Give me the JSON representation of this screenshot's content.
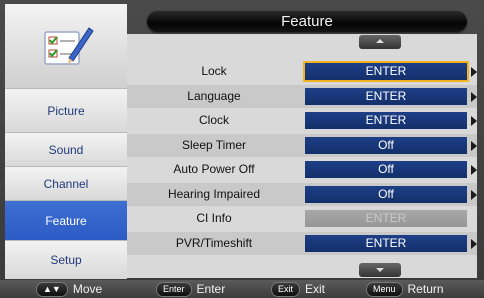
{
  "menu": {
    "title": "Feature"
  },
  "sidebar": {
    "icon": "checklist-pen-icon",
    "items": [
      {
        "label": "Picture",
        "active": false
      },
      {
        "label": "Sound",
        "active": false
      },
      {
        "label": "Channel",
        "active": false
      },
      {
        "label": "Feature",
        "active": true
      },
      {
        "label": "Setup",
        "active": false
      }
    ]
  },
  "feature_rows": [
    {
      "label": "Lock",
      "value": "ENTER",
      "state": "selected",
      "has_arrow": true
    },
    {
      "label": "Language",
      "value": "ENTER",
      "state": "normal",
      "has_arrow": true
    },
    {
      "label": "Clock",
      "value": "ENTER",
      "state": "normal",
      "has_arrow": true
    },
    {
      "label": "Sleep  Timer",
      "value": "Off",
      "state": "normal",
      "has_arrow": true
    },
    {
      "label": "Auto Power Off",
      "value": "Off",
      "state": "normal",
      "has_arrow": true
    },
    {
      "label": "Hearing Impaired",
      "value": "Off",
      "state": "normal",
      "has_arrow": true
    },
    {
      "label": "CI Info",
      "value": "ENTER",
      "state": "disabled",
      "has_arrow": false
    },
    {
      "label": "PVR/Timeshift",
      "value": "ENTER",
      "state": "normal",
      "has_arrow": true
    }
  ],
  "footer": {
    "move": {
      "key": "▲▼",
      "label": "Move"
    },
    "enter": {
      "key": "Enter",
      "label": "Enter"
    },
    "exit": {
      "key": "Exit",
      "label": "Exit"
    },
    "return": {
      "key": "Menu",
      "label": "Return"
    }
  },
  "colors": {
    "value_bg": "#1d3f86",
    "selected_outline": "#f0b422",
    "sidebar_active": "#2c5ac4",
    "disabled_value": "#a8a8a8"
  }
}
